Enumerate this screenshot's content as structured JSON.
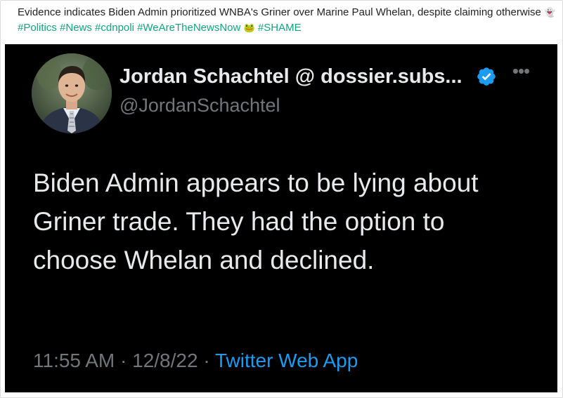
{
  "caption": {
    "text": "Evidence indicates Biden Admin prioritized WNBA's Griner over Marine Paul Whelan, despite claiming otherwise",
    "emoji_1": "👻",
    "tags_1": "#Politics #News #cdnpoli #WeAreTheNewsNow",
    "emoji_2": "🐸",
    "tag_2": "#SHAME"
  },
  "tweet": {
    "author_name": "Jordan Schachtel @ dossier.subs...",
    "handle": "@JordanSchachtel",
    "more_label": "•••",
    "text": "Biden Admin appears to be lying about Griner trade. They had the option to choose Whelan and declined.",
    "time": "11:55 AM",
    "date": "12/8/22",
    "separator": "·",
    "source": "Twitter Web App"
  },
  "colors": {
    "tag": "#14a37f",
    "tweet_bg": "#000000",
    "verified": "#1d9bf0",
    "link": "#1d9bf0"
  }
}
